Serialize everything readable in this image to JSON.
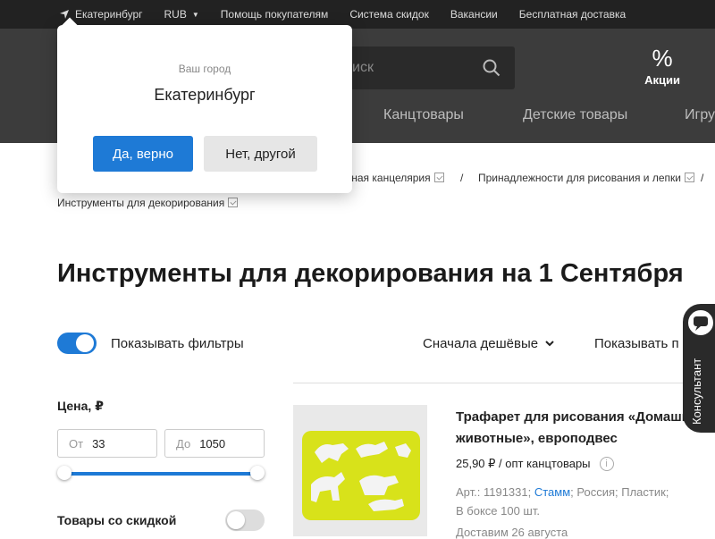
{
  "topbar": {
    "city": "Екатеринбург",
    "currency": "RUB",
    "links": [
      "Помощь покупателям",
      "Система скидок",
      "Вакансии",
      "Бесплатная доставка"
    ]
  },
  "header": {
    "search_placeholder": "Поиск",
    "search_visible": "иск",
    "promo_label": "Акции",
    "categories": [
      "Канцтовары",
      "Детские товары",
      "Игру"
    ]
  },
  "breadcrumbs": {
    "items": [
      "...льная канцелярия",
      "Принадлежности для рисования и лепки",
      "Инструменты для декорирования"
    ],
    "separator": "/"
  },
  "page_title": "Инструменты для декорирования на 1 Сентября",
  "filters": {
    "toggle_label": "Показывать фильтры",
    "sort_label": "Сначала дешёвые",
    "show_label": "Показывать п",
    "price_heading": "Цена, ₽",
    "from_placeholder": "От",
    "from_value": "33",
    "to_placeholder": "До",
    "to_value": "1050",
    "discount_label": "Товары со скидкой"
  },
  "product": {
    "title": "Трафарет для рисования «Домашн животные», европодвес",
    "price": "25,90 ₽ / опт канцтовары",
    "meta_prefix": "Арт.: 1191331; ",
    "meta_brand": "Стамм",
    "meta_suffix": "; Россия; Пластик;",
    "meta_line2": "В боксе 100 шт.",
    "delivery": "Доставим 26 августа"
  },
  "consultant": {
    "label": "Консультант"
  },
  "city_popup": {
    "question": "Ваш город",
    "city": "Екатеринбург",
    "yes_label": "Да, верно",
    "no_label": "Нет, другой"
  },
  "colors": {
    "accent": "#1e7ad6",
    "topbar": "#222222",
    "header": "#3c3c3c",
    "stencil": "#d8e21a"
  }
}
